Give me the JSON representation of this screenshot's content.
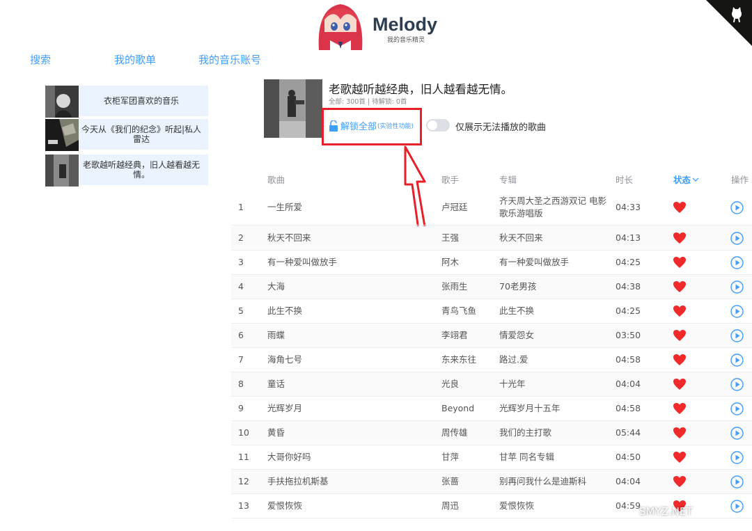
{
  "header": {
    "title": "Melody",
    "subtitle": "我的音乐精灵"
  },
  "nav": {
    "search": "搜索",
    "my_playlists": "我的歌单",
    "my_account": "我的音乐账号"
  },
  "sidebar": {
    "playlists": [
      {
        "name": "衣柜军团喜欢的音乐"
      },
      {
        "name": "今天从《我们的纪念》听起|私人雷达"
      },
      {
        "name": "老歌越听越经典，旧人越看越无情。"
      }
    ]
  },
  "playlist": {
    "title": "老歌越听越经典，旧人越看越无情。",
    "stats": "全部: 300首 | 待解锁: 0首",
    "unlock_label": "解锁全部",
    "unlock_note": "(实验性功能)",
    "toggle_label": "仅展示无法播放的歌曲"
  },
  "table": {
    "headers": {
      "song": "歌曲",
      "artist": "歌手",
      "album": "专辑",
      "duration": "时长",
      "status": "状态",
      "action": "操作"
    },
    "rows": [
      {
        "no": "1",
        "song": "一生所爱",
        "artist": "卢冠廷",
        "album": "齐天周大圣之西游双记 电影歌乐游唱版",
        "duration": "04:33"
      },
      {
        "no": "2",
        "song": "秋天不回来",
        "artist": "王强",
        "album": "秋天不回来",
        "duration": "04:13"
      },
      {
        "no": "3",
        "song": "有一种爱叫做放手",
        "artist": "阿木",
        "album": "有一种爱叫做放手",
        "duration": "04:25"
      },
      {
        "no": "4",
        "song": "大海",
        "artist": "张雨生",
        "album": "70老男孩",
        "duration": "04:38"
      },
      {
        "no": "5",
        "song": "此生不换",
        "artist": "青鸟飞鱼",
        "album": "此生不换",
        "duration": "04:25"
      },
      {
        "no": "6",
        "song": "雨蝶",
        "artist": "李翊君",
        "album": "情爱怨女",
        "duration": "03:50"
      },
      {
        "no": "7",
        "song": "海角七号",
        "artist": "东来东往",
        "album": "路过.爱",
        "duration": "04:58"
      },
      {
        "no": "8",
        "song": "童话",
        "artist": "光良",
        "album": "十光年",
        "duration": "04:04"
      },
      {
        "no": "9",
        "song": "光辉岁月",
        "artist": "Beyond",
        "album": "光辉岁月十五年",
        "duration": "04:58"
      },
      {
        "no": "10",
        "song": "黄昏",
        "artist": "周传雄",
        "album": "我们的主打歌",
        "duration": "05:44"
      },
      {
        "no": "11",
        "song": "大哥你好吗",
        "artist": "甘萍",
        "album": "甘苹 同名专辑",
        "duration": "04:50"
      },
      {
        "no": "12",
        "song": "手扶拖拉机斯基",
        "artist": "张蔷",
        "album": "别再问我什么是迪斯科",
        "duration": "04:04"
      },
      {
        "no": "13",
        "song": "爱恨恢恢",
        "artist": "周迅",
        "album": "爱恨恢恢",
        "duration": "04:59"
      }
    ]
  },
  "watermark": "SMYZ.NET",
  "colors": {
    "accent": "#409eff",
    "heart": "#f02a2a",
    "annotation": "#e8202a",
    "sidebar_bg": "#eaf3fe"
  }
}
